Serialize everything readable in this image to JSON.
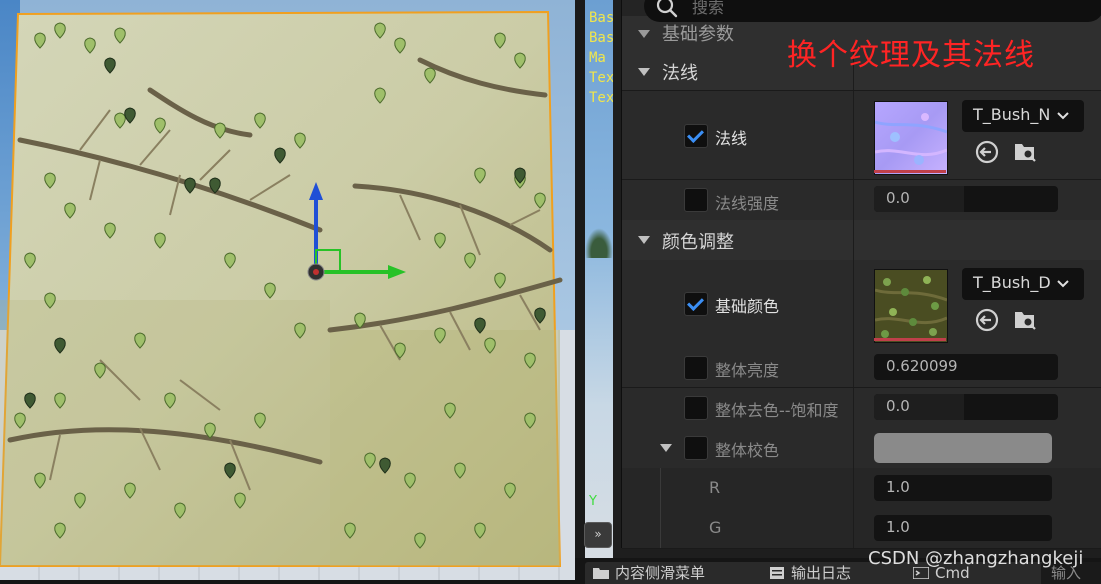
{
  "panel": {
    "search_placeholder": "搜索",
    "partial_category": "基础参数",
    "categories": [
      {
        "label": "法线"
      },
      {
        "label": "颜色调整"
      }
    ],
    "normal": {
      "label": "法线",
      "checked": true,
      "asset": "T_Bush_N"
    },
    "normal_strength": {
      "label": "法线强度",
      "checked": false,
      "value": "0.0"
    },
    "base_color": {
      "label": "基础颜色",
      "checked": true,
      "asset": "T_Bush_D"
    },
    "brightness": {
      "label": "整体亮度",
      "checked": false,
      "value": "0.620099"
    },
    "desaturation": {
      "label": "整体去色--饱和度",
      "checked": false,
      "value": "0.0"
    },
    "tint": {
      "label": "整体校色",
      "checked": false,
      "color": "#8a8a8a"
    },
    "r": {
      "label": "R",
      "value": "1.0"
    },
    "g": {
      "label": "G",
      "value": "1.0"
    }
  },
  "viewport": {
    "stats_lines": [
      "Bas",
      "Bas",
      "Ma",
      "Tex",
      "Tex"
    ],
    "axis_label": "Y",
    "collapse_label": "»"
  },
  "annotation": "换个纹理及其法线",
  "bottombar": {
    "content_drawer": "内容侧滑菜单",
    "output_log": "输出日志",
    "cmd": "Cmd",
    "input": "输入"
  },
  "watermark": "CSDN @zhangzhangkeji",
  "colors": {
    "accent": "#3b8ff5",
    "annotation": "#ff2424",
    "selection_outline": "#f0a020",
    "gizmo_x": "#27c227",
    "gizmo_z": "#1f4fd6"
  }
}
